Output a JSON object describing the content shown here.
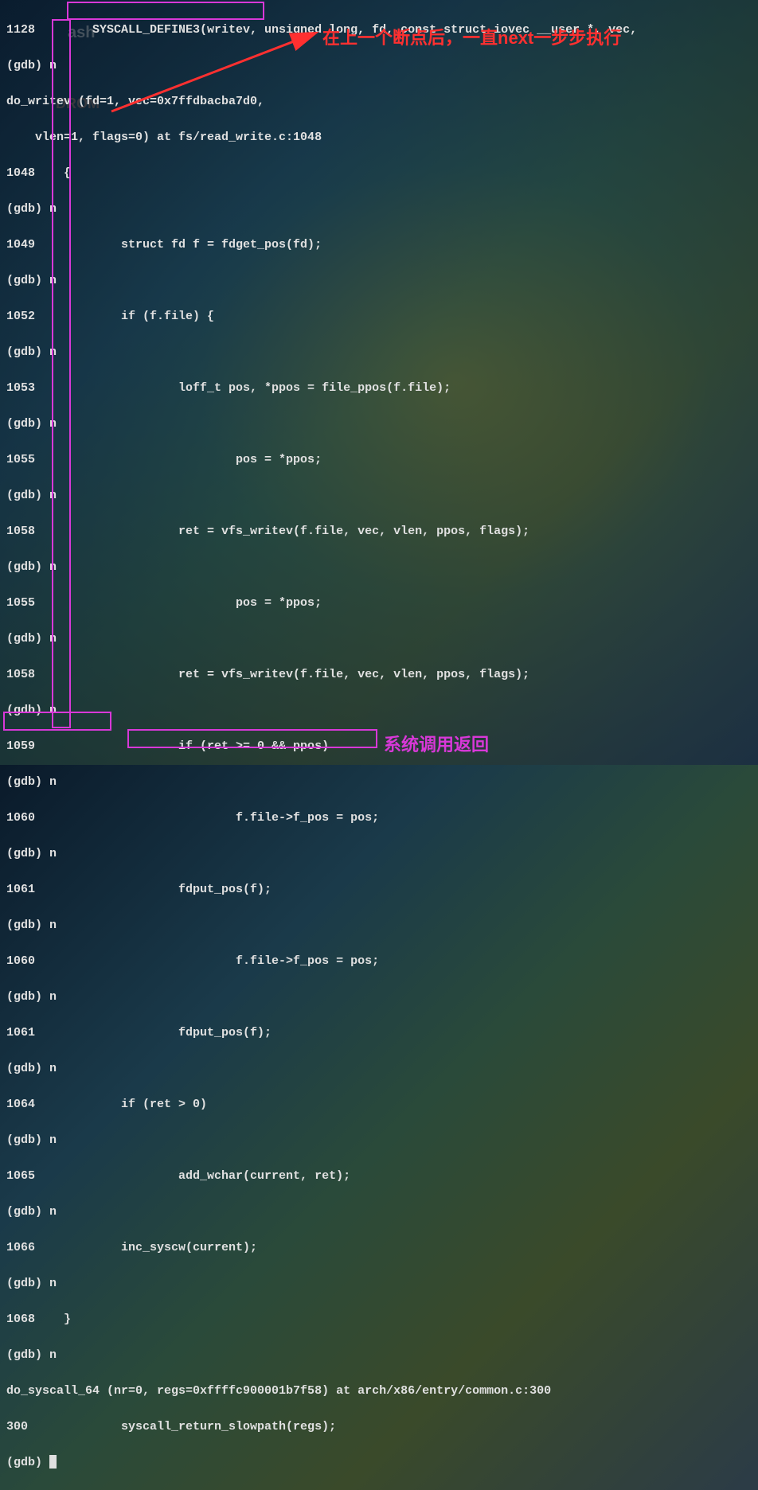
{
  "annotations": {
    "top": "在上一个断点后，一直next一步步执行",
    "bottom": "系统调用返回"
  },
  "ghost": {
    "g1": "ash",
    "g2": "DROM"
  },
  "lines": [
    "1128        SYSCALL_DEFINE3(writev, unsigned long, fd, const struct iovec __user *, vec,",
    "(gdb) n",
    "do_writev (fd=1, vec=0x7ffdbacba7d0,",
    "    vlen=1, flags=0) at fs/read_write.c:1048",
    "1048    {",
    "(gdb) n",
    "1049            struct fd f = fdget_pos(fd);",
    "(gdb) n",
    "1052            if (f.file) {",
    "(gdb) n",
    "1053                    loff_t pos, *ppos = file_ppos(f.file);",
    "(gdb) n",
    "1055                            pos = *ppos;",
    "(gdb) n",
    "1058                    ret = vfs_writev(f.file, vec, vlen, ppos, flags);",
    "(gdb) n",
    "1055                            pos = *ppos;",
    "(gdb) n",
    "1058                    ret = vfs_writev(f.file, vec, vlen, ppos, flags);",
    "(gdb) n",
    "1059                    if (ret >= 0 && ppos)",
    "(gdb) n",
    "1060                            f.file->f_pos = pos;",
    "(gdb) n",
    "1061                    fdput_pos(f);",
    "(gdb) n",
    "1060                            f.file->f_pos = pos;",
    "(gdb) n",
    "1061                    fdput_pos(f);",
    "(gdb) n",
    "1064            if (ret > 0)",
    "(gdb) n",
    "1065                    add_wchar(current, ret);",
    "(gdb) n",
    "1066            inc_syscw(current);",
    "(gdb) n",
    "1068    }",
    "(gdb) n",
    "do_syscall_64 (nr=0, regs=0xffffc900001b7f58) at arch/x86/entry/common.c:300",
    "300             syscall_return_slowpath(regs);",
    "(gdb) "
  ]
}
